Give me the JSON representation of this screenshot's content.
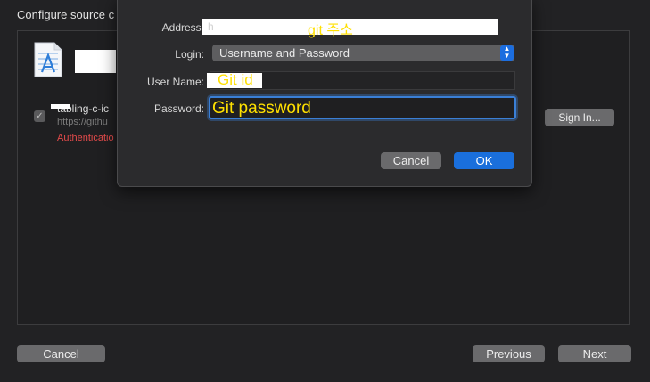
{
  "window": {
    "title": "Configure source c"
  },
  "repository": {
    "name": "tabling-c-ic",
    "url": "https://githu",
    "error": "Authenticatio"
  },
  "buttons": {
    "sign_in": "Sign In...",
    "cancel": "Cancel",
    "previous": "Previous",
    "next": "Next"
  },
  "sheet": {
    "address_label": "Address:",
    "address_fragment": "h",
    "address_annotation": "git 주소",
    "login_label": "Login:",
    "login_value": "Username and Password",
    "username_label": "User Name:",
    "username_annotation": "Git id",
    "password_label": "Password:",
    "password_annotation": "Git password",
    "cancel": "Cancel",
    "ok": "OK"
  },
  "colors": {
    "accent": "#1a6fdc",
    "error": "#e54b4b",
    "annotation": "#ffe000"
  }
}
